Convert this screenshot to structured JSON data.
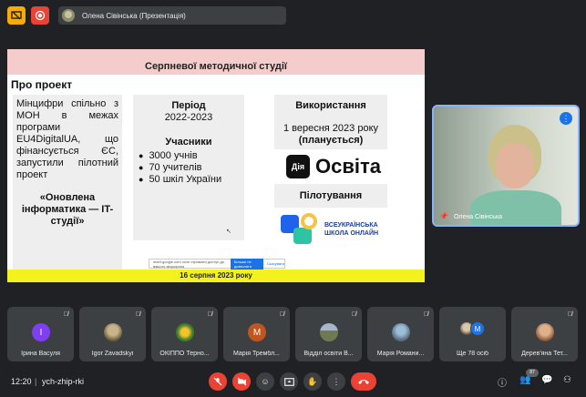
{
  "topbar": {
    "presenter_chip": "Олена Сівінська (Презентація)"
  },
  "slide": {
    "header": "Серпневої методичної студії",
    "subtitle": "Про проект",
    "col1": {
      "para1": "Мінцифри спільно з МОН в межах програми EU4DigitalUA, що фінансується ЄС, запустили пілотний проект",
      "para2": "«Оновлена інформатика — IT-студії»"
    },
    "col2": {
      "period_heading": "Період",
      "period_value": "2022-2023",
      "participants_heading": "Учасники",
      "participants": [
        "3000 учнів",
        "70 учителів",
        "50 шкіл України"
      ]
    },
    "usage": {
      "heading": "Використання",
      "date": "1 вересня 2023 року",
      "planned": "(планується)"
    },
    "diya": {
      "badge": "Дія",
      "text": "Освіта"
    },
    "pilot_heading": "Пілотування",
    "school_logo_text": [
      "ВСЕУКРАЇНСЬКА",
      "ШКОЛА ОНЛАЙН"
    ],
    "consent": {
      "text": "meet.google.com хоче отримати доступ до вашого мікрофона",
      "allow": "Більше не дозволяти",
      "other": "Скасувати"
    },
    "footer": "16 серпня 2023 року"
  },
  "camera": {
    "name": "Олена Сівінська"
  },
  "participants": [
    {
      "name": "Ірина Васуля",
      "initial": "I"
    },
    {
      "name": "Igor Zavadskyi",
      "initial": ""
    },
    {
      "name": "ОКІППО Терно...",
      "initial": ""
    },
    {
      "name": "Марія Трембл...",
      "initial": "M"
    },
    {
      "name": "Відділ освіти В...",
      "initial": ""
    },
    {
      "name": "Марія Романи...",
      "initial": ""
    },
    {
      "name": "Ще 78 осіб",
      "initial": "M"
    },
    {
      "name": "Дерев'яна Тет...",
      "initial": ""
    }
  ],
  "bottombar": {
    "time": "12:20",
    "separator": "|",
    "meeting_code": "ych-zhip-rki",
    "people_count": "87"
  },
  "colors": {
    "accent_blue": "#1a73e8",
    "hangup_red": "#ea4335",
    "header_pink": "#f4cccc",
    "footer_yellow": "#f4f21e"
  }
}
